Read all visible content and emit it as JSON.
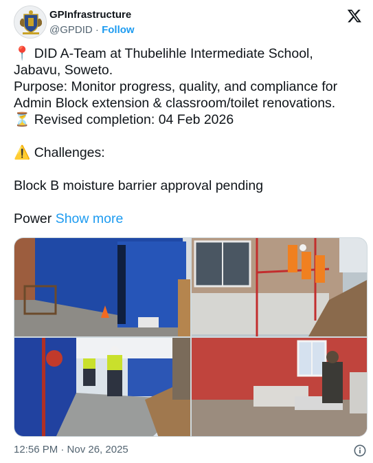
{
  "account": {
    "display_name": "GPInfrastructure",
    "handle": "@GPDID",
    "separator": " · ",
    "follow_label": "Follow"
  },
  "tweet": {
    "line1": "📍 DID A-Team at Thubelihle Intermediate School,",
    "line2": "Jabavu, Soweto.",
    "line3": "Purpose: Monitor progress, quality, and compliance for",
    "line4": "Admin Block extension & classroom/toilet renovations.",
    "line5": "⏳ Revised completion: 04 Feb 2026",
    "line6": "⚠️ Challenges:",
    "line7": "Block B moisture barrier approval pending",
    "line8_start": "Power ",
    "show_more_label": "Show more"
  },
  "media": {
    "count": 4
  },
  "footer": {
    "timestamp": "12:56 PM · Nov 26, 2025"
  },
  "icons": {
    "x_logo": "x-logo-icon",
    "info": "info-icon"
  },
  "colors": {
    "accent": "#1d9bf0",
    "text": "#0f1419",
    "muted": "#536471"
  }
}
